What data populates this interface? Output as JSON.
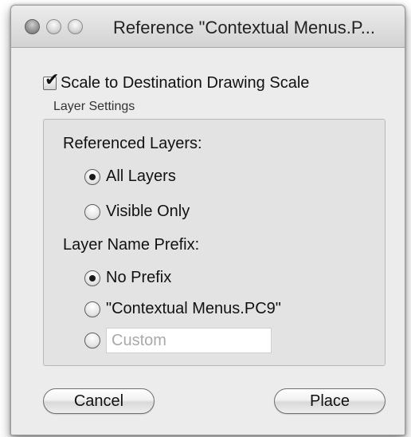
{
  "window": {
    "title": "Reference \"Contextual Menus.P..."
  },
  "scale_option": {
    "label": "Scale to Destination Drawing Scale",
    "checked": true
  },
  "layer_settings": {
    "group_label": "Layer Settings",
    "referenced_layers": {
      "label": "Referenced Layers:",
      "options": [
        "All Layers",
        "Visible Only"
      ],
      "selected": "All Layers"
    },
    "layer_name_prefix": {
      "label": "Layer Name Prefix:",
      "options": [
        "No Prefix",
        "\"Contextual Menus.PC9\"",
        "Custom"
      ],
      "selected": "No Prefix",
      "custom_placeholder": "Custom"
    }
  },
  "buttons": {
    "cancel": "Cancel",
    "place": "Place"
  }
}
